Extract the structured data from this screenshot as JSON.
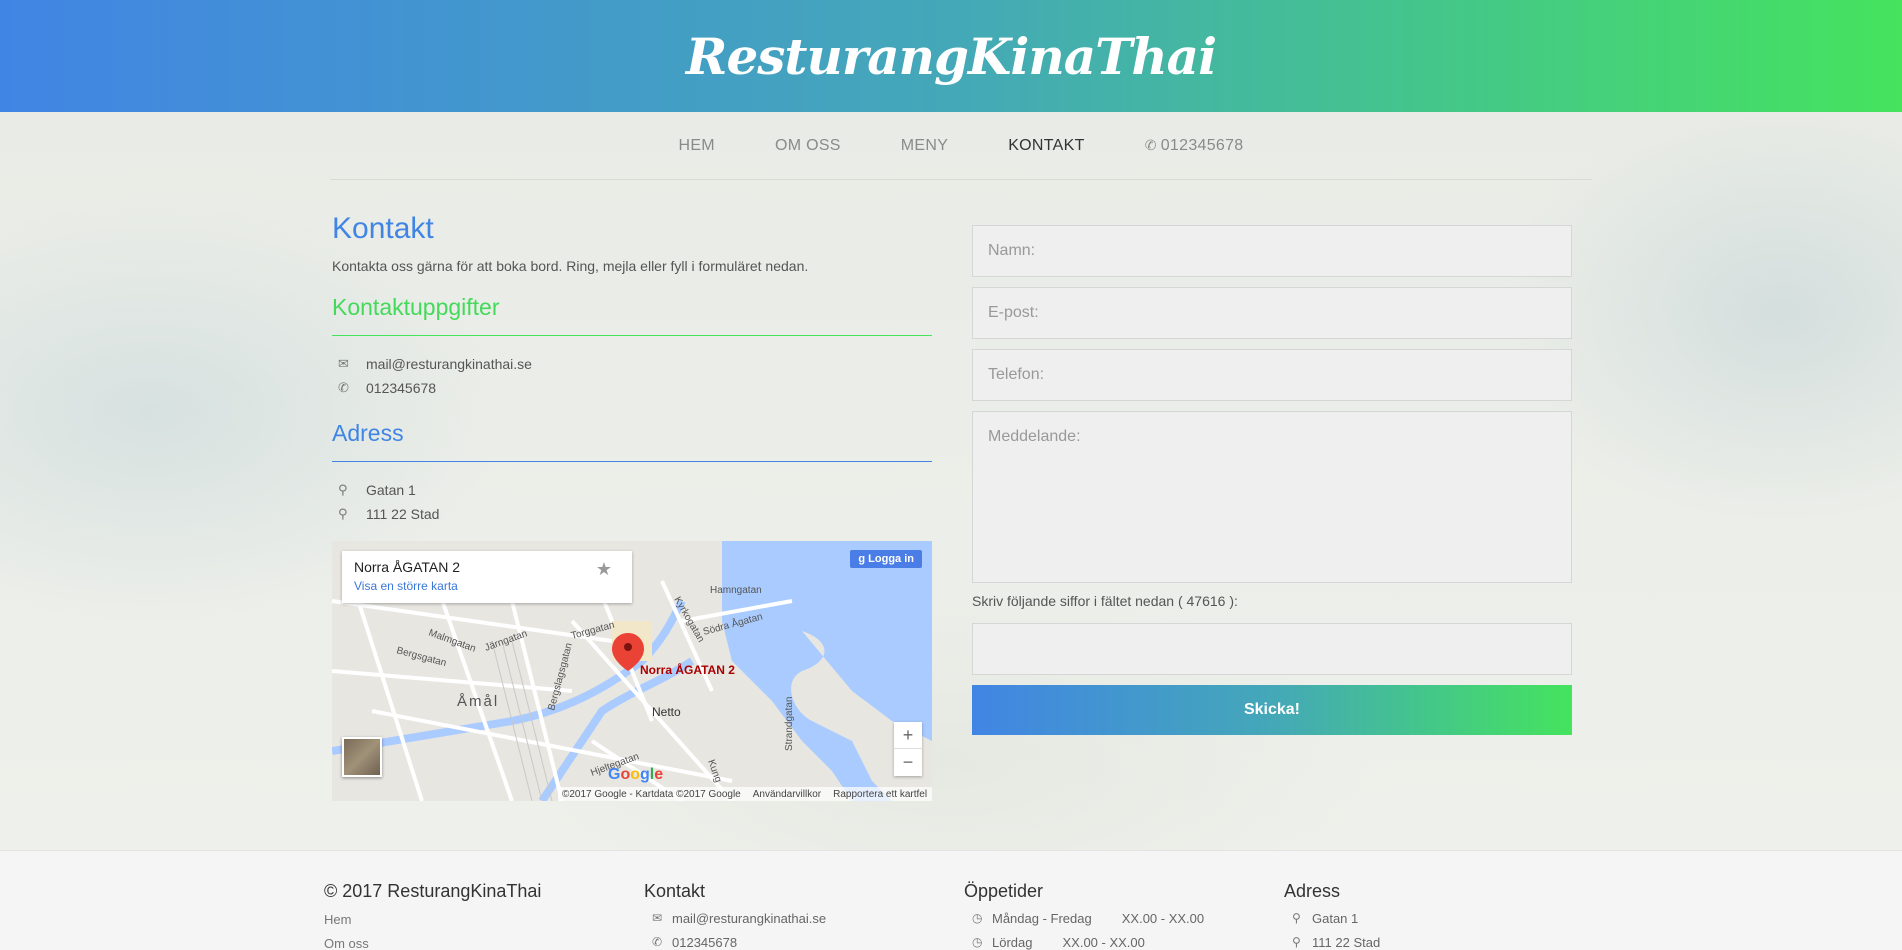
{
  "brand": "ResturangKinaThai",
  "nav": {
    "items": [
      "HEM",
      "OM OSS",
      "MENY",
      "KONTAKT"
    ],
    "phone": "012345678"
  },
  "contact": {
    "title": "Kontakt",
    "intro": "Kontakta oss gärna för att boka bord. Ring, mejla eller fyll i formuläret nedan.",
    "details_title": "Kontaktuppgifter",
    "email": "mail@resturangkinathai.se",
    "phone": "012345678",
    "address_title": "Adress",
    "street": "Gatan 1",
    "city": "111 22 Stad"
  },
  "map": {
    "place": "Norra ÅGATAN 2",
    "larger_map": "Visa en större karta",
    "login": "Logga in",
    "pin_label": "Norra ÅGATAN 2",
    "city_label": "Åmål",
    "poi": "Netto",
    "streets": [
      "Hamngatan",
      "Kyrkogatan",
      "Södra Ågatan",
      "Torggatan",
      "Järngatan",
      "Malmgatan",
      "Bergsgatan",
      "Bergslagsgatan",
      "Strandgatan",
      "Hjeltegatan",
      "Kung"
    ],
    "footer": [
      "©2017 Google - Kartdata ©2017 Google",
      "Användarvillkor",
      "Rapportera ett kartfel"
    ],
    "zoom_in": "+",
    "zoom_out": "−"
  },
  "form": {
    "name": "Namn:",
    "email": "E-post:",
    "phone": "Telefon:",
    "message": "Meddelande:",
    "captcha_text": "Skriv följande siffor i fältet nedan (  47616  ):",
    "submit": "Skicka!"
  },
  "footer": {
    "copyright": "© 2017 ResturangKinaThai",
    "links": [
      "Hem",
      "Om oss"
    ],
    "contact_title": "Kontakt",
    "email": "mail@resturangkinathai.se",
    "phone": "012345678",
    "hours_title": "Öppetider",
    "hours": [
      {
        "days": "Måndag - Fredag",
        "time": "XX.00 - XX.00"
      },
      {
        "days": "Lördag",
        "time": "XX.00 - XX.00"
      }
    ],
    "address_title": "Adress",
    "street": "Gatan 1",
    "city": "111 22 Stad"
  },
  "colors": {
    "brand_blue": "#4185e4",
    "brand_green": "#45e35e"
  }
}
